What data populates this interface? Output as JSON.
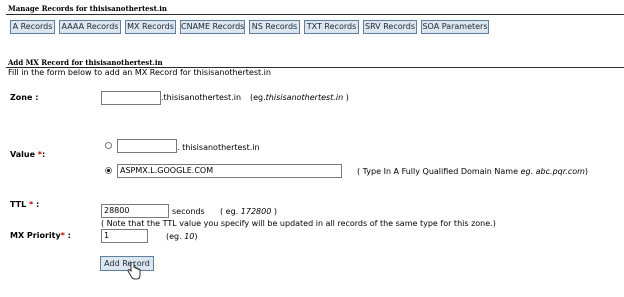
{
  "manage": {
    "title": "Manage Records for thisisanothertest.in"
  },
  "tabs": [
    {
      "label": "A Records"
    },
    {
      "label": "AAAA Records"
    },
    {
      "label": "MX Records"
    },
    {
      "label": "CNAME Records"
    },
    {
      "label": "NS Records"
    },
    {
      "label": "TXT Records"
    },
    {
      "label": "SRV Records"
    },
    {
      "label": "SOA Parameters"
    }
  ],
  "add": {
    "title": "Add MX Record for thisisanothertest.in",
    "instruction": "Fill in the form below to add an MX Record for thisisanothertest.in"
  },
  "zone": {
    "label": "Zone :",
    "value": "",
    "suffix": ".thisisanothertest.in",
    "example_prefix": "(eg.",
    "example": "thisisanothertest.in",
    "example_suffix": ")"
  },
  "value_field": {
    "label": "Value",
    "required_mark": " *",
    "colon": ":",
    "option1_value": "",
    "option1_suffix": ". thisisanothertest.in",
    "option2_value": "ASPMX.L.GOOGLE.COM",
    "option2_hint_prefix": "( Type In A Fully Qualified Domain Name",
    "option2_hint_example": "eg. abc.pqr.com",
    "option2_hint_suffix": ")"
  },
  "ttl": {
    "label": "TTL",
    "required_mark": " *",
    "colon": " :",
    "value": "28800",
    "unit": "seconds",
    "example_prefix": "( eg.",
    "example": "172800",
    "example_suffix": " )",
    "note": "( Note that the TTL value you specify will be updated in all records of the same type for this zone.)"
  },
  "mx_priority": {
    "label": "MX Priority",
    "required_mark": "*",
    "colon": " :",
    "value": "1",
    "example_prefix": "(eg.",
    "example": "10",
    "example_suffix": ")"
  },
  "submit": {
    "label": "Add Record"
  }
}
